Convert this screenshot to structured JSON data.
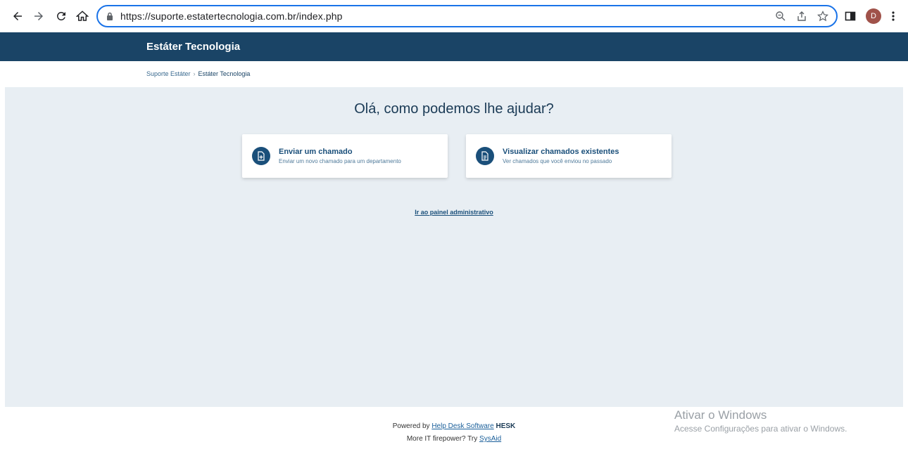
{
  "browser": {
    "url": "https://suporte.estatertecnologia.com.br/index.php",
    "profile_initial": "D"
  },
  "header": {
    "brand": "Estáter Tecnologia"
  },
  "breadcrumb": {
    "items": [
      "Suporte Estáter",
      "Estáter Tecnologia"
    ],
    "separator": "›"
  },
  "main": {
    "heading": "Olá, como podemos lhe ajudar?",
    "cards": [
      {
        "title": "Enviar um chamado",
        "description": "Enviar um novo chamado para um departamento",
        "icon": "add-document-icon"
      },
      {
        "title": "Visualizar chamados existentes",
        "description": "Ver chamados que você enviou no passado",
        "icon": "document-icon"
      }
    ],
    "admin_link": "Ir ao painel administrativo"
  },
  "footer": {
    "line1_prefix": "Powered by",
    "line1_link": "Help Desk Software",
    "line1_brand": "HESK",
    "line2_prefix": "More IT firepower? Try",
    "line2_link": "SysAid"
  },
  "watermark": {
    "title": "Ativar o Windows",
    "subtitle": "Acesse Configurações para ativar o Windows."
  },
  "colors": {
    "header_bg": "#1a4466",
    "main_bg": "#e8eef3",
    "accent": "#1a4f7a"
  }
}
